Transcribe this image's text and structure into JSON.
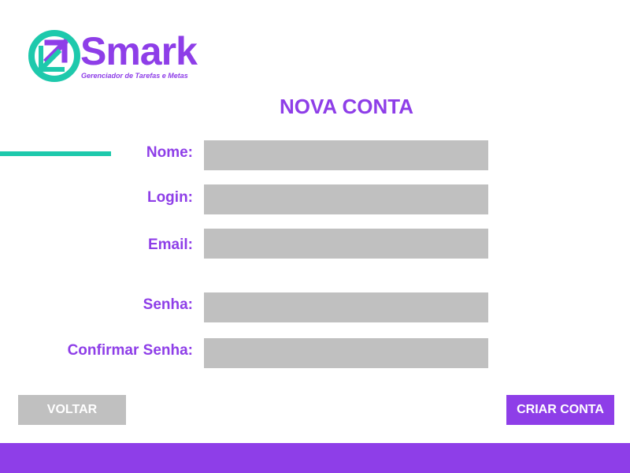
{
  "logo": {
    "name": "Smark",
    "tagline": "Gerenciador de Tarefas e Metas"
  },
  "page": {
    "title": "NOVA CONTA"
  },
  "form": {
    "name_label": "Nome:",
    "name_value": "",
    "login_label": "Login:",
    "login_value": "",
    "email_label": "Email:",
    "email_value": "",
    "password_label": "Senha:",
    "password_value": "",
    "confirm_password_label": "Confirmar Senha:",
    "confirm_password_value": ""
  },
  "actions": {
    "back_label": "VOLTAR",
    "create_label": "CRIAR CONTA"
  },
  "colors": {
    "primary": "#8e3ee8",
    "accent": "#1ec9ac",
    "field_background": "#c0c0c0",
    "secondary_button": "#c0c0c0"
  },
  "icons": {
    "logo_mark": "arrow-up-right-in-circle-icon"
  }
}
